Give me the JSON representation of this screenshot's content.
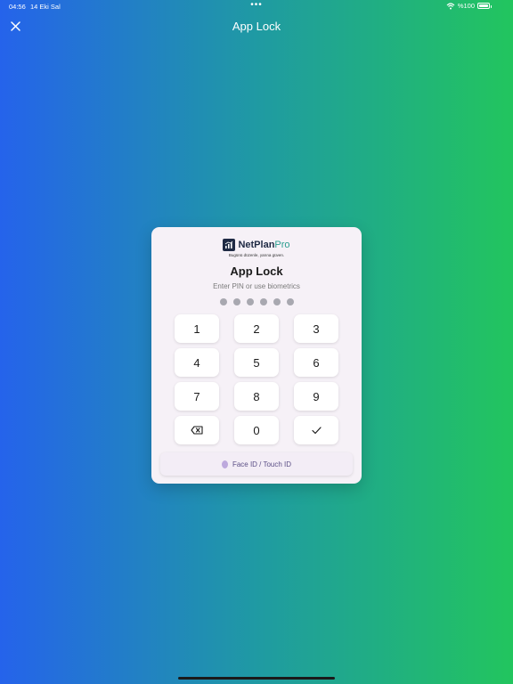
{
  "status_bar": {
    "time": "04:56",
    "date": "14 Eki Sal",
    "dots": "•••",
    "battery_text": "%100"
  },
  "top_bar": {
    "title": "App Lock"
  },
  "card": {
    "brand_main": "NetPlan",
    "brand_accent": "Pro",
    "tagline": "Bugünü düzenle, yarına güven.",
    "title": "App Lock",
    "subtitle": "Enter PIN or use biometrics",
    "pin_length": 6,
    "keypad": {
      "k1": "1",
      "k2": "2",
      "k3": "3",
      "k4": "4",
      "k5": "5",
      "k6": "6",
      "k7": "7",
      "k8": "8",
      "k9": "9",
      "k0": "0"
    },
    "biometric_label": "Face ID / Touch ID"
  },
  "colors": {
    "gradient_start": "#2563eb",
    "gradient_end": "#22c55e",
    "card_bg": "#f6f1f7",
    "brand_dark": "#1f2a44",
    "brand_accent": "#2a9d8f"
  }
}
